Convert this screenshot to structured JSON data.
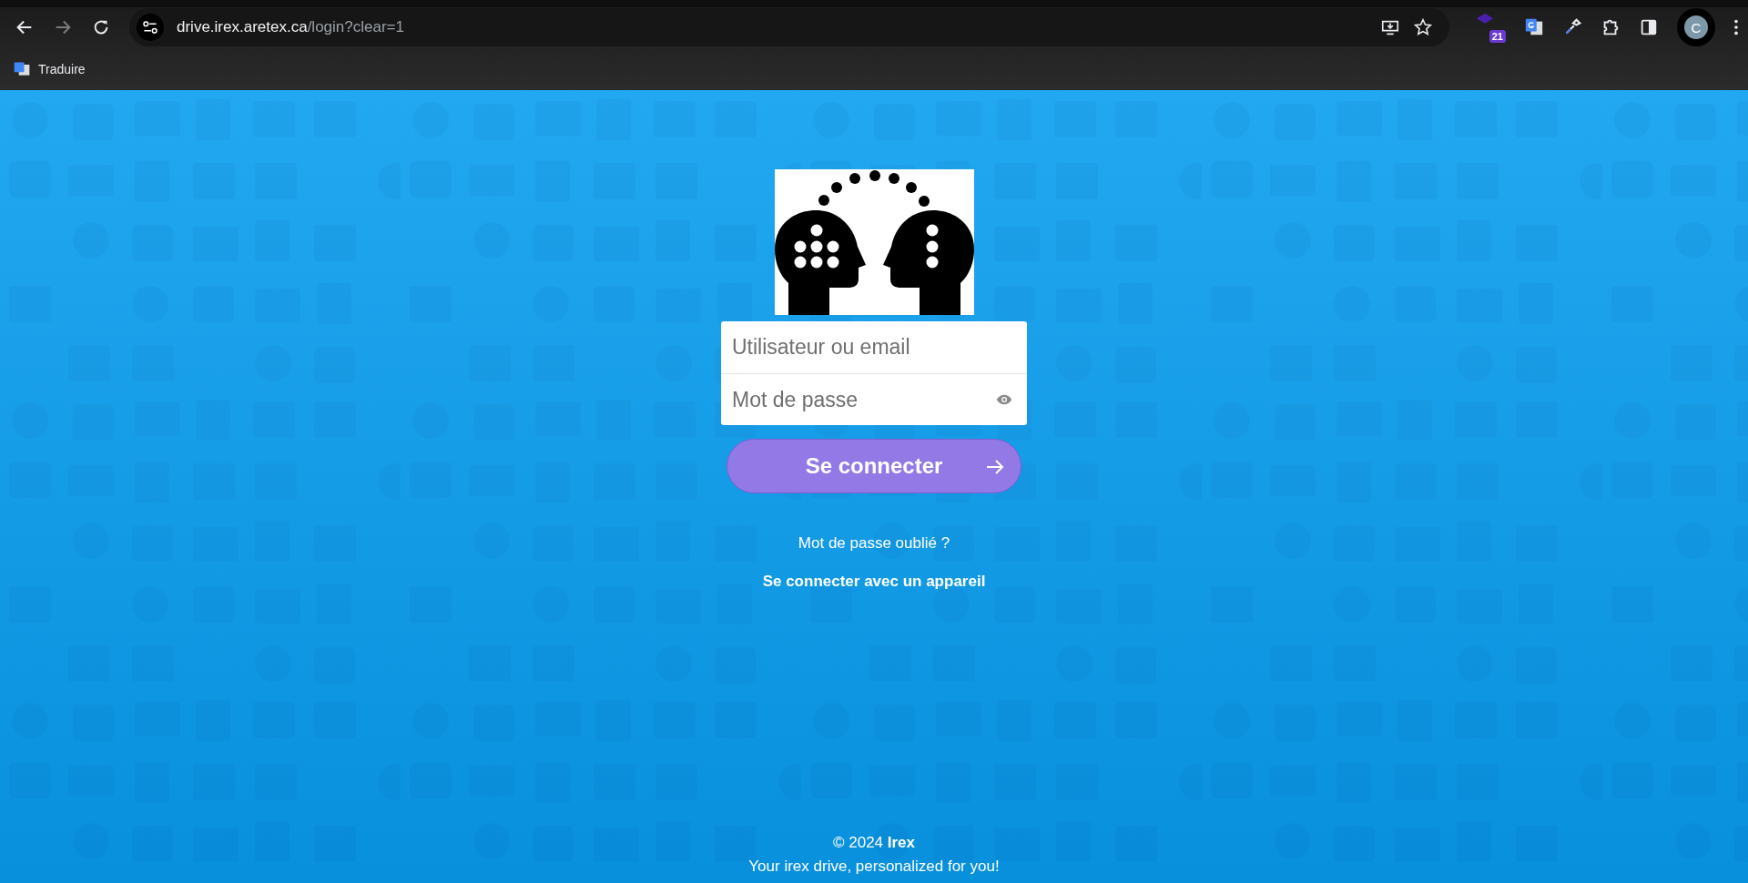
{
  "browser": {
    "forward_disabled": true,
    "url_host": "drive.irex.aretex.ca",
    "url_path": "/login?clear=1",
    "extension_badge": "21",
    "profile_initial": "C",
    "bookmarks": [
      {
        "label": "Traduire"
      }
    ]
  },
  "login": {
    "username": {
      "placeholder": "Utilisateur ou email"
    },
    "password": {
      "placeholder": "Mot de passe"
    },
    "submit": "Se connecter",
    "links": [
      "Mot de passe oublié ?",
      "Se connecter avec un appareil"
    ]
  },
  "footer": {
    "copyright": "© 2024 **Irex**",
    "tagline": "Your irex drive, personalized for you!"
  }
}
